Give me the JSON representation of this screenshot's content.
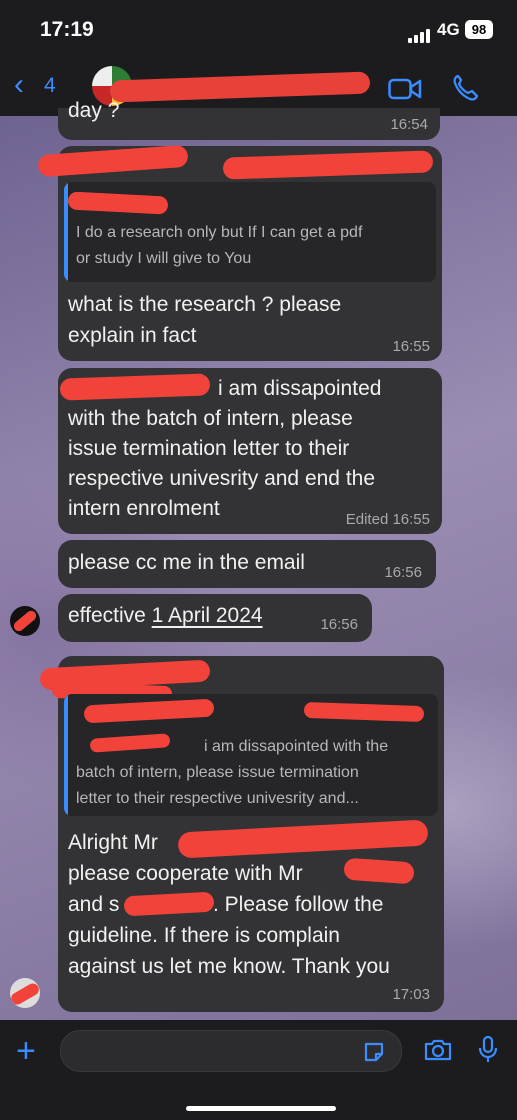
{
  "status": {
    "time": "17:19",
    "network": "4G",
    "battery": "98"
  },
  "header": {
    "back_count": "4",
    "title": ""
  },
  "messages": {
    "m0": {
      "text": "day ?",
      "time": "16:54"
    },
    "m1": {
      "quote_text_1": "I do a research only but If I can get a pdf",
      "quote_text_2": "or study I will give to You",
      "line1": "what is the research ? please",
      "line2": "explain in fact",
      "time": "16:55"
    },
    "m2": {
      "line1": "i am dissapointed",
      "line2": "with the batch of intern, please",
      "line3": "issue termination letter to their",
      "line4": "respective univesrity and end the",
      "line5": "intern enrolment",
      "edited": "Edited 16:55"
    },
    "m3": {
      "text": "please cc me in the email",
      "time": "16:56"
    },
    "m4": {
      "prefix": "effective ",
      "link": "1 April 2024",
      "time": "16:56"
    },
    "m5": {
      "quote_line1": "i am dissapointed with the",
      "quote_line2": "batch of intern, please issue termination",
      "quote_line3": "letter to their respective univesrity and...",
      "line1": "Alright Mr",
      "line2": "please cooperate with Mr",
      "line3a": "and s",
      "line3b": ". Please follow the",
      "line4": "guideline. If there is complain",
      "line5": "against us let me know. Thank you",
      "time": "17:03"
    }
  },
  "composer": {
    "placeholder": ""
  },
  "colors": {
    "accent": "#3a8cff",
    "bubble": "#333235",
    "redaction": "#f2433b"
  },
  "icons": [
    "back-chevron-icon",
    "video-call-icon",
    "phone-icon",
    "plus-icon",
    "sticker-icon",
    "camera-icon",
    "microphone-icon"
  ]
}
